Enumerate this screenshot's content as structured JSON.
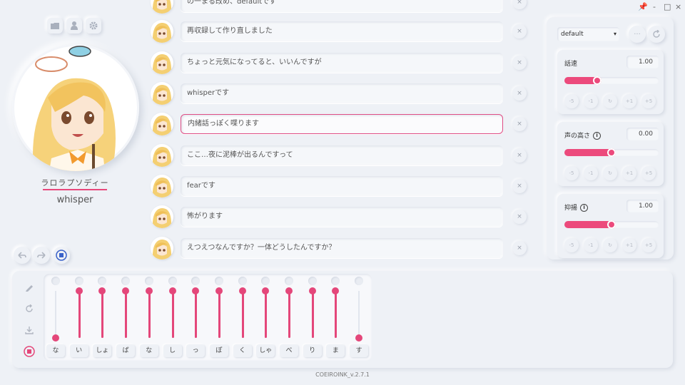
{
  "window": {
    "pin_icon": "pin-icon",
    "minimize": "-",
    "maximize": "□",
    "close": "×"
  },
  "left_panel": {
    "top_icons": [
      "folder-icon",
      "person-icon",
      "gear-icon"
    ],
    "character_name": "ラロラプソディー",
    "style_name": "whisper",
    "history": [
      "undo-icon",
      "redo-icon",
      "play-stop-icon"
    ]
  },
  "messages": [
    {
      "text": "の一まる改め、defaultです",
      "active": false
    },
    {
      "text": "再収録して作り直しました",
      "active": false
    },
    {
      "text": "ちょっと元気になってると、いいんですが",
      "active": false
    },
    {
      "text": "whisperです",
      "active": false
    },
    {
      "text": "内緒話っぽく喋ります",
      "active": true
    },
    {
      "text": "ここ…夜に泥棒が出るんですって",
      "active": false
    },
    {
      "text": "fearです",
      "active": false
    },
    {
      "text": "怖がります",
      "active": false
    },
    {
      "text": "えつえつなんですか？一体どうしたんですか？",
      "active": false
    }
  ],
  "close_label": "×",
  "right_panel": {
    "style_select": "default",
    "more_icon": "ellipsis-icon",
    "refresh_icon": "refresh-icon",
    "params": [
      {
        "label": "話速",
        "value": "1.00",
        "fill": 0.35,
        "info": false
      },
      {
        "label": "声の高さ",
        "value": "0.00",
        "fill": 0.5,
        "info": true
      },
      {
        "label": "抑揚",
        "value": "1.00",
        "fill": 0.5,
        "info": true
      }
    ],
    "steps": [
      "-5",
      "-1",
      "↻",
      "+1",
      "+5"
    ]
  },
  "bottom_panel": {
    "tools": [
      "pencil-icon",
      "refresh-icon",
      "download-icon",
      "record-icon"
    ],
    "mora": [
      {
        "label": "な",
        "level": 0.0
      },
      {
        "label": "い",
        "level": 1.0
      },
      {
        "label": "しょ",
        "level": 1.0
      },
      {
        "label": "ば",
        "level": 1.0
      },
      {
        "label": "な",
        "level": 1.0
      },
      {
        "label": "し",
        "level": 1.0
      },
      {
        "label": "っ",
        "level": 1.0
      },
      {
        "label": "ぽ",
        "level": 1.0
      },
      {
        "label": "く",
        "level": 1.0
      },
      {
        "label": "しゃ",
        "level": 1.0
      },
      {
        "label": "べ",
        "level": 1.0
      },
      {
        "label": "り",
        "level": 1.0
      },
      {
        "label": "ま",
        "level": 1.0
      },
      {
        "label": "す",
        "level": 0.0
      }
    ]
  },
  "version": "COEIROINK_v.2.7.1",
  "colors": {
    "accent": "#e8487b",
    "background": "#eef1f6"
  }
}
